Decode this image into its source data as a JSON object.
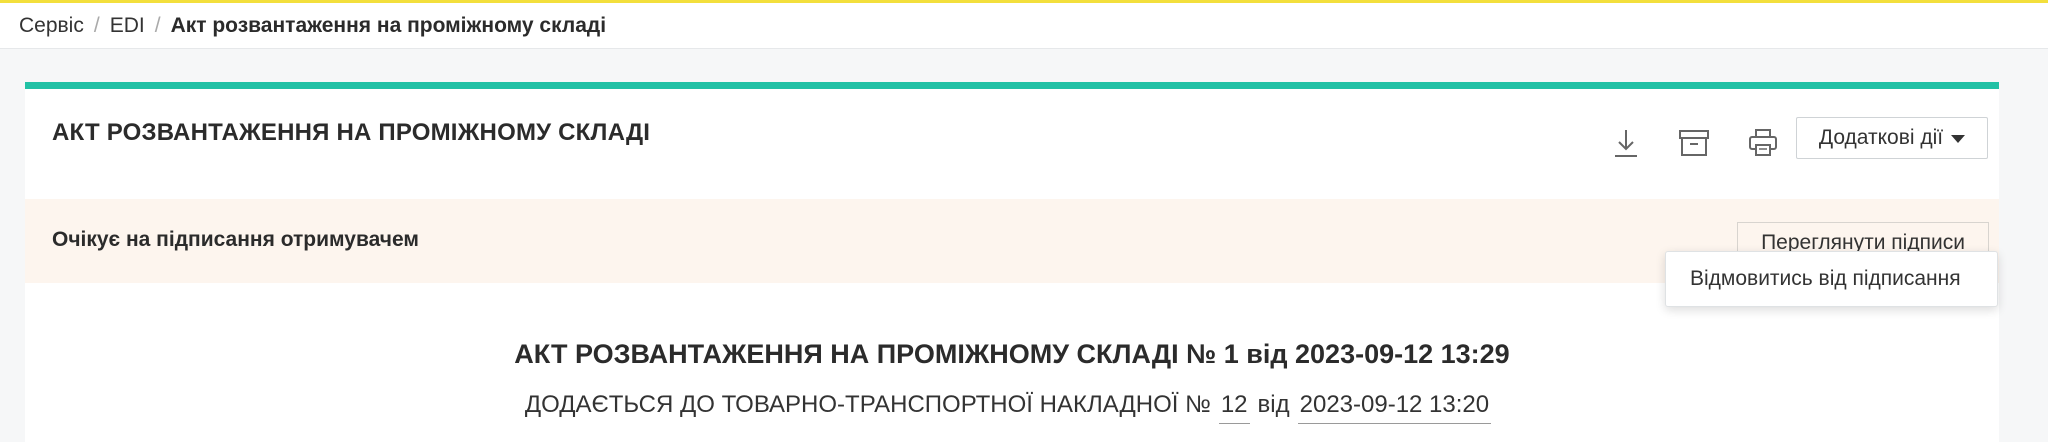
{
  "breadcrumb": {
    "items": [
      "Сервіс",
      "EDI"
    ],
    "separator": "/",
    "current": "Акт розвантаження на проміжному складі"
  },
  "header": {
    "title": "АКТ РОЗВАНТАЖЕННЯ НА ПРОМІЖНОМУ СКЛАДІ",
    "actions_label": "Додаткові дії",
    "icons": [
      "download-icon",
      "archive-icon",
      "print-icon"
    ]
  },
  "dropdown": {
    "items": [
      "Відмовитись від підписання"
    ]
  },
  "status": {
    "text": "Очікує на підписання отримувачем",
    "view_signatures_label": "Переглянути підписи"
  },
  "document": {
    "title": "АКТ РОЗВАНТАЖЕННЯ НА ПРОМІЖНОМУ СКЛАДІ № 1 від 2023-09-12 13:29",
    "sub_prefix": "ДОДАЄТЬСЯ ДО ТОВАРНО-ТРАНСПОРТНОЇ НАКЛАДНОЇ №",
    "waybill_number": "12",
    "sub_from": "від",
    "waybill_date": "2023-09-12 13:20"
  },
  "colors": {
    "accent": "#21c1a5",
    "top_line": "#f3df3c",
    "status_bg": "#fdf5ee"
  }
}
